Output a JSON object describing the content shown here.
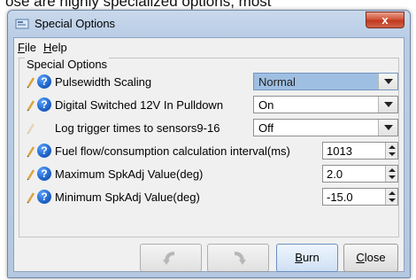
{
  "background_text": "ose are highly specialized options, most",
  "window": {
    "title": "Special Options",
    "close_glyph": "x"
  },
  "menubar": {
    "file_label_u": "F",
    "file_label_rest": "ile",
    "help_label_u": "H",
    "help_label_rest": "elp"
  },
  "group": {
    "title": "Special Options"
  },
  "rows": [
    {
      "label": "Pulsewidth Scaling",
      "value": "Normal",
      "control": "combo",
      "selected": true
    },
    {
      "label": "Digital Switched 12V In Pulldown",
      "value": "On",
      "control": "combo"
    },
    {
      "label": "Log trigger times to sensors9-16",
      "value": "Off",
      "control": "combo"
    },
    {
      "label": "Fuel flow/consumption calculation interval(ms)",
      "value": "1013",
      "control": "spinner"
    },
    {
      "label": "Maximum SpkAdj Value(deg)",
      "value": "2.0",
      "control": "spinner"
    },
    {
      "label": "Minimum SpkAdj Value(deg)",
      "value": "-15.0",
      "control": "spinner"
    }
  ],
  "buttons": {
    "undo_icon": "undo-icon",
    "redo_icon": "redo-icon",
    "burn_u": "B",
    "burn_rest": "urn",
    "close_u": "C",
    "close_rest": "lose"
  },
  "colors": {
    "selected_field": "#9fbfe2",
    "help_icon": "#1f63c9",
    "close_button": "#c0391d"
  }
}
